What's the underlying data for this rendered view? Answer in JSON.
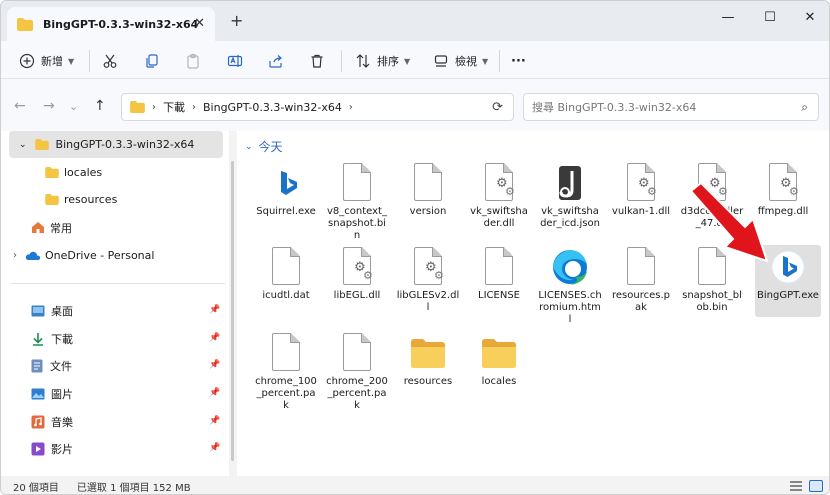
{
  "titlebar": {
    "tab_title": "BingGPT-0.3.3-win32-x64",
    "close": "✕",
    "new_tab": "+",
    "minimize": "—",
    "maximize": "☐",
    "close_window": "✕"
  },
  "toolbar": {
    "new_label": "新增",
    "sort_label": "排序",
    "view_label": "檢視",
    "more_label": "···"
  },
  "address": {
    "segments": [
      "下載",
      "BingGPT-0.3.3-win32-x64"
    ],
    "search_placeholder": "搜尋 BingGPT-0.3.3-win32-x64"
  },
  "sidebar": {
    "items": [
      {
        "label": "BingGPT-0.3.3-win32-x64"
      },
      {
        "label": "locales"
      },
      {
        "label": "resources"
      },
      {
        "label": "常用"
      },
      {
        "label": "OneDrive - Personal"
      },
      {
        "label": "桌面"
      },
      {
        "label": "下載"
      },
      {
        "label": "文件"
      },
      {
        "label": "圖片"
      },
      {
        "label": "音樂"
      },
      {
        "label": "影片"
      }
    ]
  },
  "content": {
    "group_header": "今天",
    "files": [
      {
        "name": "Squirrel.exe",
        "icon": "bing-icon"
      },
      {
        "name": "v8_context_snapshot.bin",
        "icon": "file-icon"
      },
      {
        "name": "version",
        "icon": "file-icon"
      },
      {
        "name": "vk_swiftshader.dll",
        "icon": "dll-icon"
      },
      {
        "name": "vk_swiftshader_icd.json",
        "icon": "json-icon"
      },
      {
        "name": "vulkan-1.dll",
        "icon": "dll-icon"
      },
      {
        "name": "d3dcompiler_47.dll",
        "icon": "dll-icon"
      },
      {
        "name": "ffmpeg.dll",
        "icon": "dll-icon"
      },
      {
        "name": "icudtl.dat",
        "icon": "file-icon"
      },
      {
        "name": "libEGL.dll",
        "icon": "dll-icon"
      },
      {
        "name": "libGLESv2.dll",
        "icon": "dll-icon"
      },
      {
        "name": "LICENSE",
        "icon": "file-icon"
      },
      {
        "name": "LICENSES.chromium.html",
        "icon": "edge-icon"
      },
      {
        "name": "resources.pak",
        "icon": "file-icon"
      },
      {
        "name": "snapshot_blob.bin",
        "icon": "file-icon"
      },
      {
        "name": "BingGPT.exe",
        "icon": "bing-icon"
      },
      {
        "name": "chrome_100_percent.pak",
        "icon": "file-icon"
      },
      {
        "name": "chrome_200_percent.pak",
        "icon": "file-icon"
      },
      {
        "name": "resources",
        "icon": "folder-icon"
      },
      {
        "name": "locales",
        "icon": "folder-icon"
      }
    ]
  },
  "status": {
    "count": "20 個項目",
    "selected": "已選取 1 個項目 152 MB"
  },
  "colors": {
    "accent": "#2a67c6",
    "arrow": "#e0141b",
    "folder": "#f4c542"
  }
}
